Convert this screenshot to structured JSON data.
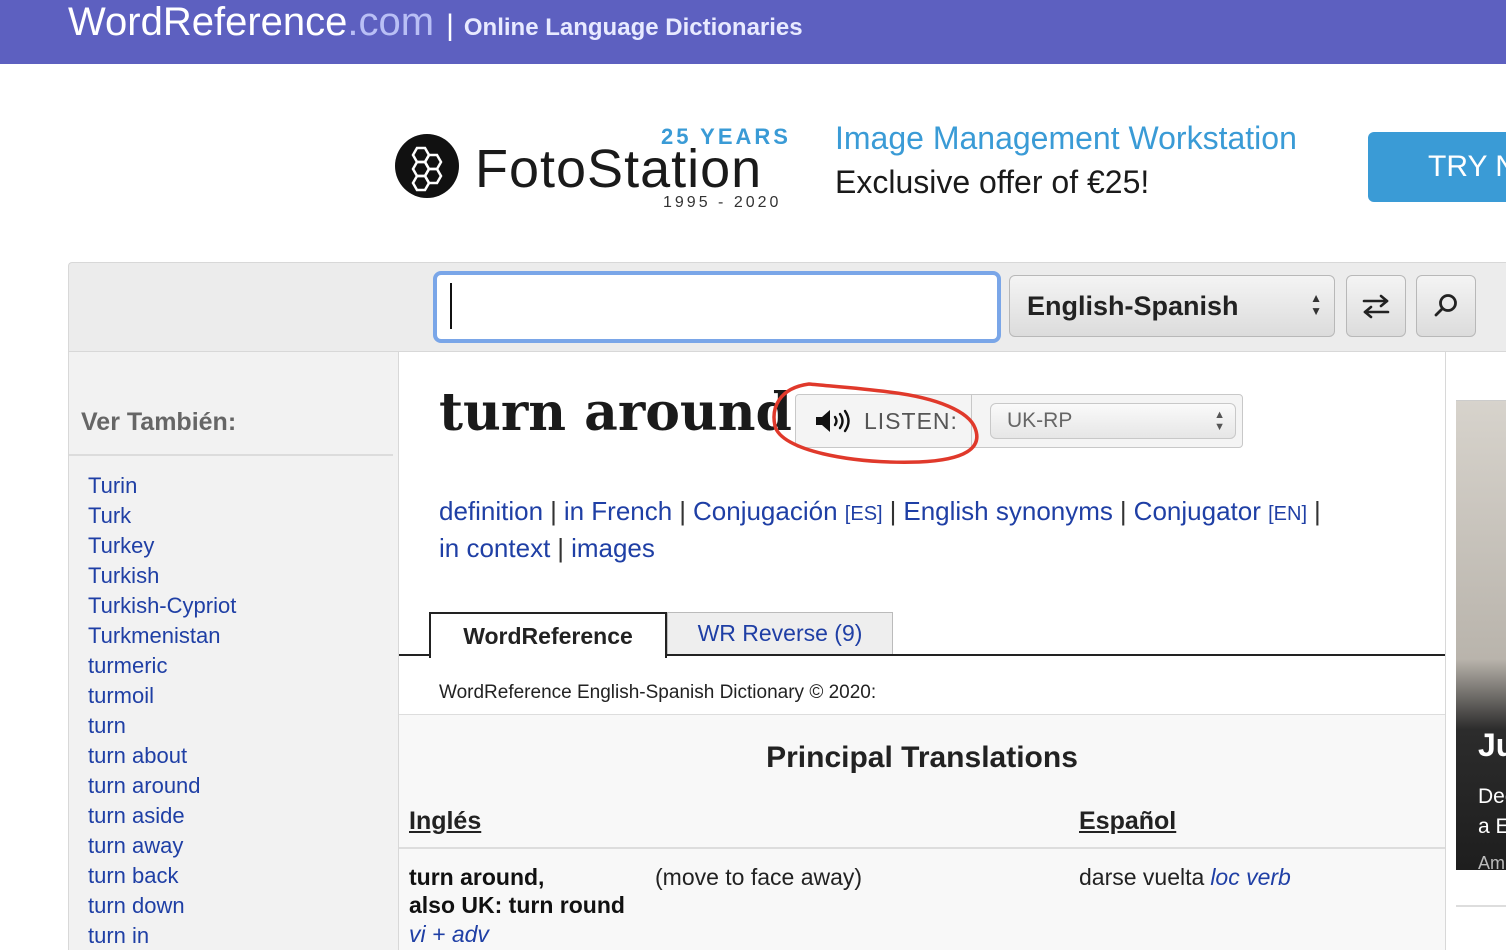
{
  "header": {
    "logo_main": "WordReference",
    "logo_com": ".com",
    "logo_sep": "|",
    "tagline": "Online Language Dictionaries"
  },
  "ad": {
    "years": "25 YEARS",
    "brand": "FotoStation",
    "dates": "1995 - 2020",
    "headline": "Image Management Workstation",
    "offer": "Exclusive offer of €25!",
    "cta": "TRY N",
    "accent_color": "#3a9bd6"
  },
  "search": {
    "value": "",
    "language_pair": "English-Spanish",
    "arrows": "▲▼",
    "swap_icon": "swap-arrows-icon",
    "search_icon": "magnifier-icon"
  },
  "sidebar": {
    "title": "Ver También:",
    "items": [
      "Turin",
      "Turk",
      "Turkey",
      "Turkish",
      "Turkish-Cypriot",
      "Turkmenistan",
      "turmeric",
      "turmoil",
      "turn",
      "turn about",
      "turn around",
      "turn aside",
      "turn away",
      "turn back",
      "turn down",
      "turn in"
    ]
  },
  "entry": {
    "headword": "turn around",
    "listen_label": "LISTEN:",
    "accent": "UK-RP",
    "annotation_color": "#e0392b"
  },
  "links": {
    "definition": "definition",
    "in_french": "in French",
    "conjugacion": "Conjugación",
    "conjugacion_tag": "[ES]",
    "synonyms": "English synonyms",
    "conjugator": "Conjugator",
    "conjugator_tag": "[EN]",
    "in_context": "in context",
    "images": "images",
    "separator": "|"
  },
  "tabs": {
    "active": "WordReference",
    "inactive": "WR Reverse (9)"
  },
  "dictionary": {
    "credit": "WordReference English-Spanish Dictionary © 2020:",
    "section_title": "Principal Translations",
    "col_en": "Inglés",
    "col_es": "Español",
    "rows": [
      {
        "term_line1": "turn around,",
        "term_line2": "also UK: turn round",
        "pos": "vi + adv",
        "sense": "(move to face away)",
        "translation": "darse vuelta",
        "translation_pos": "loc verb"
      }
    ]
  },
  "right_ad": {
    "title": "Ju",
    "line1": "Dec",
    "line2": "a E",
    "line3": "Am"
  },
  "colors": {
    "header_bg": "#5d60c0",
    "link": "#1f3fa5"
  }
}
